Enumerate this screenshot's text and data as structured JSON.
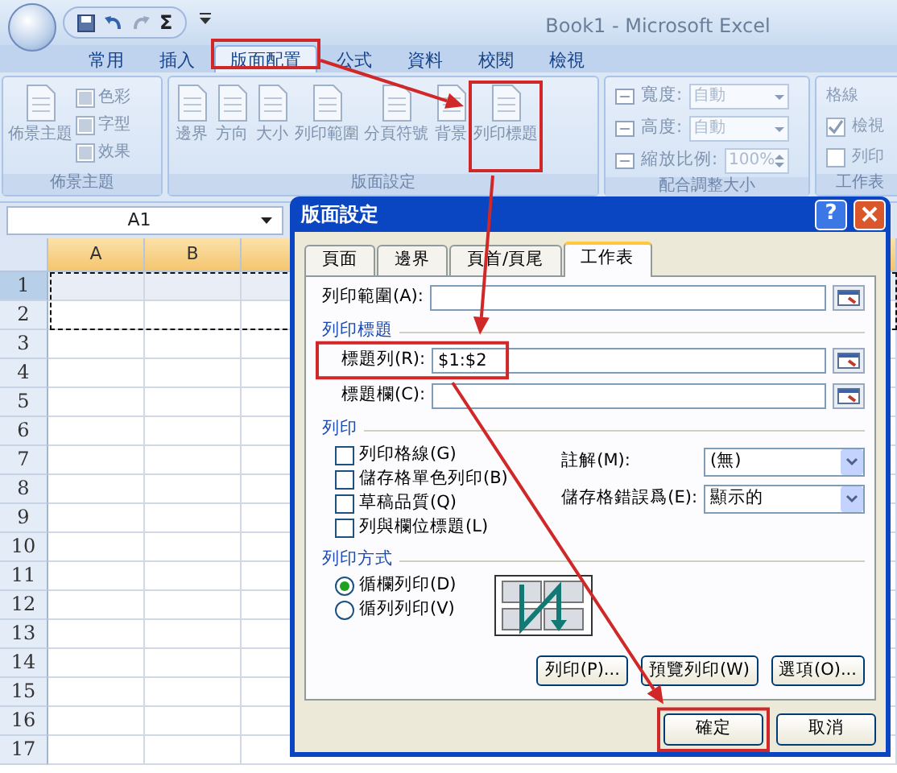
{
  "window": {
    "title": "Book1 - Microsoft Excel"
  },
  "quick_access": {
    "sum_label": "Σ"
  },
  "ribbon_tabs": [
    {
      "label": "常用",
      "selected": false
    },
    {
      "label": "插入",
      "selected": false
    },
    {
      "label": "版面配置",
      "selected": true
    },
    {
      "label": "公式",
      "selected": false
    },
    {
      "label": "資料",
      "selected": false
    },
    {
      "label": "校閱",
      "selected": false
    },
    {
      "label": "檢視",
      "selected": false
    }
  ],
  "ribbon_groups": [
    {
      "title": "佈景主題",
      "items": [
        {
          "kind": "large",
          "label": "佈景主題"
        },
        {
          "kind": "small",
          "label": "色彩"
        },
        {
          "kind": "small",
          "label": "字型"
        },
        {
          "kind": "small",
          "label": "效果"
        }
      ]
    },
    {
      "title": "版面設定",
      "items": [
        {
          "kind": "large",
          "label": "邊界"
        },
        {
          "kind": "large",
          "label": "方向"
        },
        {
          "kind": "large",
          "label": "大小"
        },
        {
          "kind": "large",
          "label": "列印範圍"
        },
        {
          "kind": "large",
          "label": "分頁符號"
        },
        {
          "kind": "large",
          "label": "背景"
        },
        {
          "kind": "large",
          "label": "列印標題"
        }
      ]
    },
    {
      "title": "配合調整大小",
      "items": [
        {
          "kind": "field",
          "label": "寬度:",
          "value": "自動"
        },
        {
          "kind": "field",
          "label": "高度:",
          "value": "自動"
        },
        {
          "kind": "spin",
          "label": "縮放比例:",
          "value": "100%"
        }
      ]
    },
    {
      "title": "工作表",
      "items": [
        {
          "kind": "heading",
          "label": "格線"
        },
        {
          "kind": "check",
          "label": "檢視",
          "checked": true
        },
        {
          "kind": "check",
          "label": "列印",
          "checked": false
        }
      ]
    }
  ],
  "formula_bar": {
    "name_box": "A1"
  },
  "sheet": {
    "columns": [
      "A",
      "B"
    ],
    "rows": [
      {
        "label": "1",
        "selected": true
      },
      {
        "label": "2",
        "selected": false
      },
      {
        "label": "3",
        "selected": false
      },
      {
        "label": "4",
        "selected": false
      },
      {
        "label": "5",
        "selected": false
      },
      {
        "label": "6",
        "selected": false
      },
      {
        "label": "7",
        "selected": false
      },
      {
        "label": "8",
        "selected": false
      },
      {
        "label": "9",
        "selected": false
      },
      {
        "label": "10",
        "selected": false
      },
      {
        "label": "11",
        "selected": false
      },
      {
        "label": "12",
        "selected": false
      },
      {
        "label": "13",
        "selected": false
      },
      {
        "label": "14",
        "selected": false
      },
      {
        "label": "15",
        "selected": false
      },
      {
        "label": "16",
        "selected": false
      },
      {
        "label": "17",
        "selected": false
      }
    ]
  },
  "dialog": {
    "title": "版面設定",
    "help_label": "?",
    "tabs": [
      {
        "label": "頁面",
        "selected": false
      },
      {
        "label": "邊界",
        "selected": false
      },
      {
        "label": "頁首/頁尾",
        "selected": false
      },
      {
        "label": "工作表",
        "selected": true
      }
    ],
    "print_area": {
      "label": "列印範圍(A):"
    },
    "print_titles": {
      "heading": "列印標題",
      "rows": {
        "label": "標題列(R):",
        "value": "$1:$2"
      },
      "columns": {
        "label": "標題欄(C):"
      }
    },
    "print": {
      "heading": "列印",
      "options": [
        {
          "label": "列印格線(G)",
          "checked": false
        },
        {
          "label": "儲存格單色列印(B)",
          "checked": false
        },
        {
          "label": "草稿品質(Q)",
          "checked": false
        },
        {
          "label": "列與欄位標題(L)",
          "checked": false
        }
      ],
      "selects": [
        {
          "label": "註解(M):",
          "value": "(無)"
        },
        {
          "label": "儲存格錯誤爲(E):",
          "value": "顯示的"
        }
      ]
    },
    "page_order": {
      "heading": "列印方式",
      "options": [
        {
          "label": "循欄列印(D)",
          "selected": true
        },
        {
          "label": "循列列印(V)",
          "selected": false
        }
      ]
    },
    "buttons": [
      "列印(P)...",
      "預覽列印(W)",
      "選項(O)..."
    ],
    "footer_buttons": [
      "確定",
      "取消"
    ]
  }
}
